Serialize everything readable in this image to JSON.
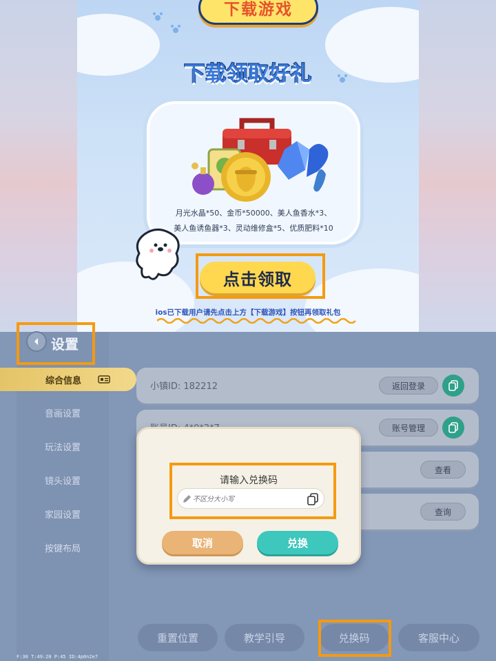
{
  "promo": {
    "download_game_label": "下载游戏",
    "title": "下载领取好礼",
    "gift_line1": "月光水晶*50、金币*50000、美人鱼香水*3、",
    "gift_line2": "美人鱼诱鱼器*3、灵动维修盒*5、优质肥料*10",
    "claim_label": "点击领取",
    "ios_note": "ios已下载用户请先点击上方【下载游戏】按钮再领取礼包"
  },
  "settings": {
    "title": "设置",
    "sidebar": [
      {
        "label": "综合信息",
        "active": true
      },
      {
        "label": "音画设置"
      },
      {
        "label": "玩法设置"
      },
      {
        "label": "镜头设置"
      },
      {
        "label": "家园设置"
      },
      {
        "label": "按键布局"
      }
    ],
    "rows": {
      "town_id_label": "小镇ID:  182212",
      "back_login": "返回登录",
      "account_id_label": "账号ID:  4*0*2*7",
      "account_manage": "账号管理",
      "view": "查看",
      "query": "查询"
    },
    "tabs": [
      "重置位置",
      "教学引导",
      "兑换码",
      "客服中心"
    ],
    "debug": "F:30   T:49:20   P:45   ID:4p0n2e7"
  },
  "modal": {
    "prompt": "请输入兑换码",
    "placeholder": "不区分大小写",
    "cancel": "取消",
    "confirm": "兑换"
  },
  "colors": {
    "highlight": "#f59a10",
    "confirm": "#3ec7bd",
    "cancel": "#e9b476",
    "active_tab": "#e4c468"
  }
}
